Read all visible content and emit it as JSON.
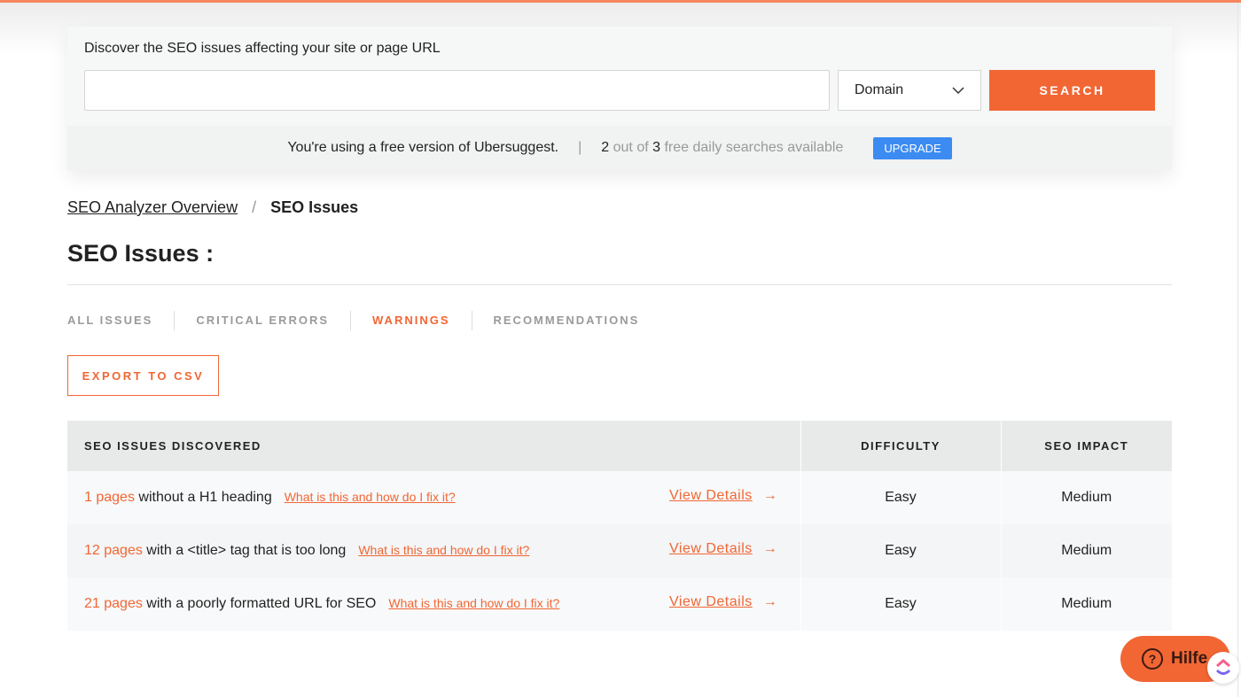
{
  "search": {
    "prompt": "Discover the SEO issues affecting your site or page URL",
    "input_value": "",
    "input_placeholder": "",
    "type_selected": "Domain",
    "search_label": "SEARCH"
  },
  "free_bar": {
    "message": "You're using a free version of Ubersuggest.",
    "used": "2",
    "out_of": "out of",
    "total": "3",
    "suffix": "free daily searches available",
    "upgrade_label": "UPGRADE"
  },
  "breadcrumb": {
    "parent": "SEO Analyzer Overview",
    "separator": "/",
    "current": "SEO Issues"
  },
  "page_title": "SEO Issues :",
  "tabs": [
    {
      "label": "ALL ISSUES"
    },
    {
      "label": "CRITICAL ERRORS"
    },
    {
      "label": "WARNINGS",
      "active": true
    },
    {
      "label": "RECOMMENDATIONS"
    }
  ],
  "export_label": "EXPORT TO CSV",
  "table": {
    "headers": [
      "SEO ISSUES DISCOVERED",
      "DIFFICULTY",
      "SEO IMPACT"
    ],
    "rows": [
      {
        "count": "1 pages",
        "text": "without a H1 heading",
        "fix": "What is this and how do I fix it?",
        "view": "View Details",
        "difficulty": "Easy",
        "impact": "Medium"
      },
      {
        "count": "12 pages",
        "text": "with a <title> tag that is too long",
        "fix": "What is this and how do I fix it?",
        "view": "View Details",
        "difficulty": "Easy",
        "impact": "Medium"
      },
      {
        "count": "21 pages",
        "text": "with a poorly formatted URL for SEO",
        "fix": "What is this and how do I fix it?",
        "view": "View Details",
        "difficulty": "Easy",
        "impact": "Medium"
      }
    ]
  },
  "help_label": "Hilfe",
  "colors": {
    "accent": "#f26634",
    "upgrade": "#3b8bf2"
  }
}
